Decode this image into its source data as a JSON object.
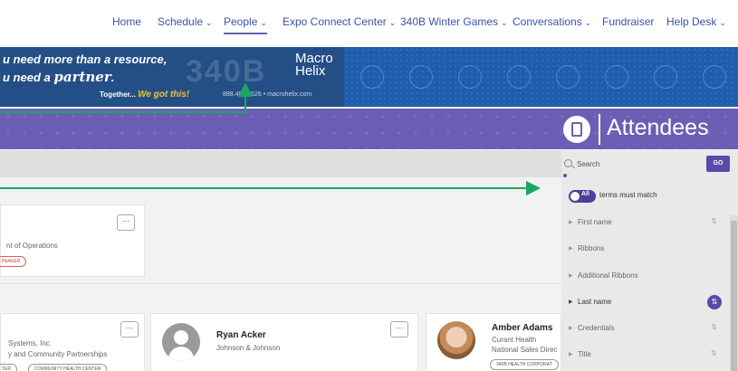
{
  "nav": {
    "items": [
      {
        "label": "Home",
        "chevron": false
      },
      {
        "label": "Schedule",
        "chevron": true
      },
      {
        "label": "People",
        "chevron": true,
        "active": true
      },
      {
        "label": "Expo Connect Center",
        "chevron": true
      },
      {
        "label": "340B Winter Games",
        "chevron": true
      },
      {
        "label": "Conversations",
        "chevron": true
      },
      {
        "label": "Fundraiser",
        "chevron": false
      },
      {
        "label": "Help Desk",
        "chevron": true
      }
    ],
    "chevron_glyph": "⌄"
  },
  "banner": {
    "line1": "u need more than a resource,",
    "line2_prefix": "u need a ",
    "line2_script": "partner",
    "line2_suffix": ".",
    "watermark": "340B",
    "together": "Together... ",
    "tagline": "We got this!",
    "contact": "888.462.4526  •  macrohelix.com",
    "logo_line1": "Macro",
    "logo_line2": "Helix"
  },
  "header": {
    "title": "Attendees",
    "icon": "attendees-icon"
  },
  "panel": {
    "search_placeholder": "Search",
    "go_label": "GO",
    "toggle_label": "All",
    "toggle_text": "terms must match",
    "filters": [
      {
        "label": "First name",
        "sort": "⇅",
        "active": false
      },
      {
        "label": "Ribbons",
        "sort": "",
        "active": false
      },
      {
        "label": "Additional Ribbons",
        "sort": "",
        "active": false
      },
      {
        "label": "Last name",
        "sort": "⇅",
        "active": true
      },
      {
        "label": "Credentials",
        "sort": "⇅",
        "active": false
      },
      {
        "label": "Title",
        "sort": "⇅",
        "active": false
      }
    ]
  },
  "cards": {
    "more": "···",
    "first": {
      "title": "nt of Operations",
      "ribbon": "PEAKER"
    },
    "row2_left": {
      "org": "Systems, Inc.",
      "title": "y and Community Partnerships",
      "ribbon1": "TER",
      "ribbon2": "COMMUNITY HEALTH CENTER"
    },
    "ryan": {
      "name": "Ryan Acker",
      "org": "Johnson & Johnson"
    },
    "amber": {
      "name": "Amber Adams",
      "org": "Curant Health",
      "title": "National Sales Direc",
      "ribbon": "340B HEALTH CORPORAT"
    }
  },
  "colors": {
    "nav_link": "#3d52a8",
    "purple": "#6a5fb5",
    "go_button": "#5a4aa8",
    "arrow": "#1aa564"
  }
}
